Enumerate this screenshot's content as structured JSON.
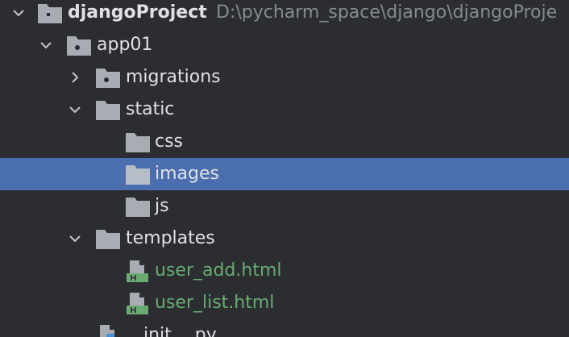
{
  "project_tree": {
    "root": {
      "name": "djangoProject",
      "path": "D:\\pycharm_space\\django\\djangoProje",
      "icon": "module-folder-icon"
    },
    "items": [
      {
        "label": "app01",
        "icon": "package-folder-icon"
      },
      {
        "label": "migrations",
        "icon": "package-folder-icon"
      },
      {
        "label": "static",
        "icon": "folder-icon"
      },
      {
        "label": "css",
        "icon": "folder-icon"
      },
      {
        "label": "images",
        "icon": "folder-icon"
      },
      {
        "label": "js",
        "icon": "folder-icon"
      },
      {
        "label": "templates",
        "icon": "folder-icon"
      },
      {
        "label": "user_add.html",
        "icon": "html-file-icon"
      },
      {
        "label": "user_list.html",
        "icon": "html-file-icon"
      },
      {
        "label": "__init__.py",
        "icon": "python-file-icon"
      }
    ]
  },
  "colors": {
    "background": "#2b2d30",
    "selection": "#4b6eaf",
    "text": "#dfe1e5",
    "path_text": "#868a91",
    "new_file_text": "#6aab73",
    "folder": "#a9adb3"
  }
}
